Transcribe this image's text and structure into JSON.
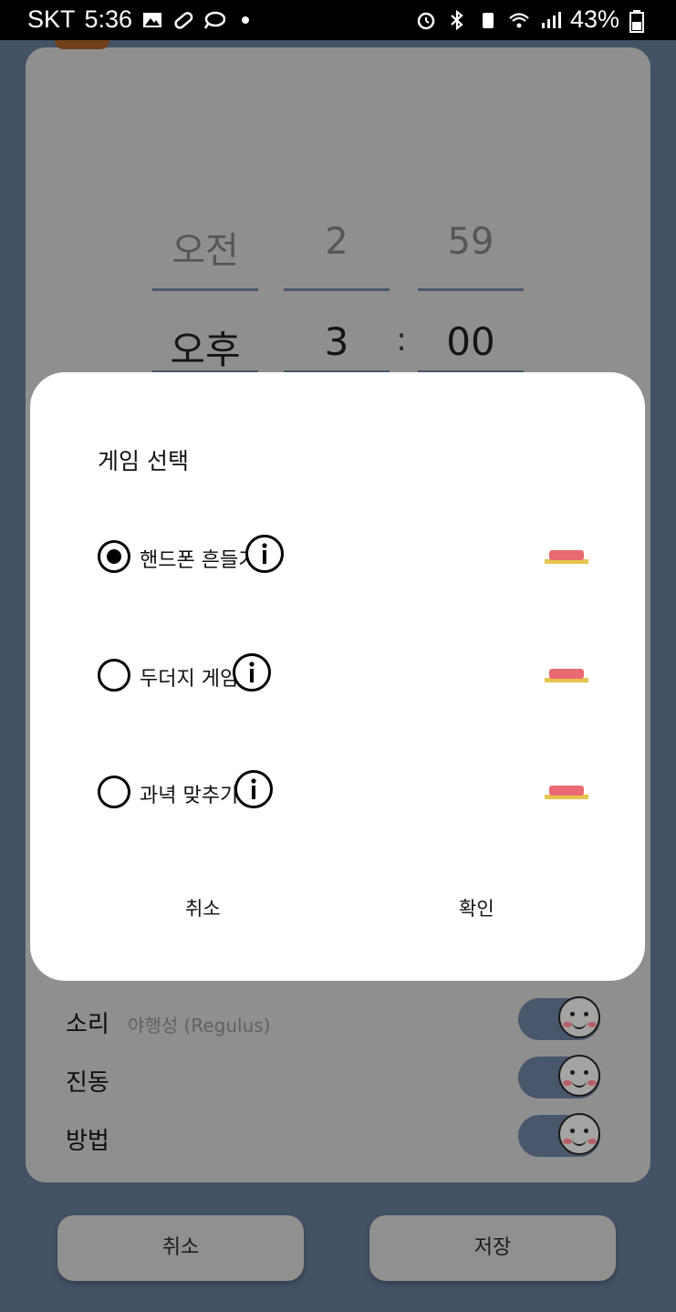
{
  "status_bar": {
    "carrier": "SKT",
    "time": "5:36",
    "battery": "43%",
    "icons_left": [
      "image-icon",
      "pill-icon",
      "chat-icon",
      "dot-icon"
    ],
    "icons_right": [
      "alarm-icon",
      "bluetooth-icon",
      "recycle-icon",
      "wifi-icon",
      "signal-icon",
      "battery-icon"
    ]
  },
  "time_picker": {
    "ampm": {
      "prev": "오전",
      "current": "오후"
    },
    "hour": {
      "prev": "2",
      "current": "3"
    },
    "separator": ":",
    "minute": {
      "prev": "59",
      "current": "00"
    }
  },
  "settings": [
    {
      "label": "소리",
      "value": "야행성 (Regulus)",
      "toggle": true
    },
    {
      "label": "진동",
      "value": "",
      "toggle": true
    },
    {
      "label": "방법",
      "value": "",
      "toggle": true
    }
  ],
  "footer": {
    "cancel": "취소",
    "save": "저장"
  },
  "dialog": {
    "title": "게임 선택",
    "options": [
      {
        "label": "핸드폰 흔들기",
        "selected": true
      },
      {
        "label": "두더지 게임",
        "selected": false
      },
      {
        "label": "과녁 맞추기",
        "selected": false
      }
    ],
    "cancel": "취소",
    "confirm": "확인"
  },
  "colors": {
    "background": "#53647d",
    "card": "#afafac",
    "dialog": "#ffffff",
    "buzzer": "#e96a72"
  }
}
